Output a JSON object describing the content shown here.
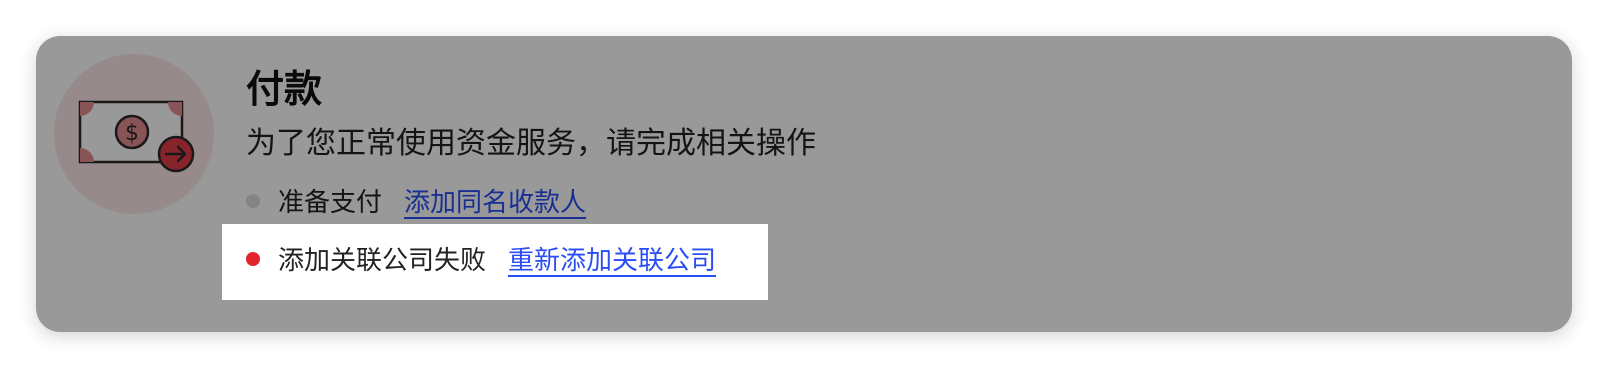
{
  "payment_card": {
    "title": "付款",
    "subtitle": "为了您正常使用资金服务，请完成相关操作",
    "icon": "money-transfer-icon",
    "steps": [
      {
        "status": "pending",
        "label": "准备支付",
        "action": "添加同名收款人"
      },
      {
        "status": "failed",
        "label": "添加关联公司失败",
        "action": "重新添加关联公司"
      }
    ]
  },
  "colors": {
    "link": "#2b4df5",
    "error_dot": "#e3242b",
    "pending_dot": "#dcdcdc",
    "icon_accent": "#d9534f",
    "overlay": "rgba(0,0,0,0.40)"
  }
}
